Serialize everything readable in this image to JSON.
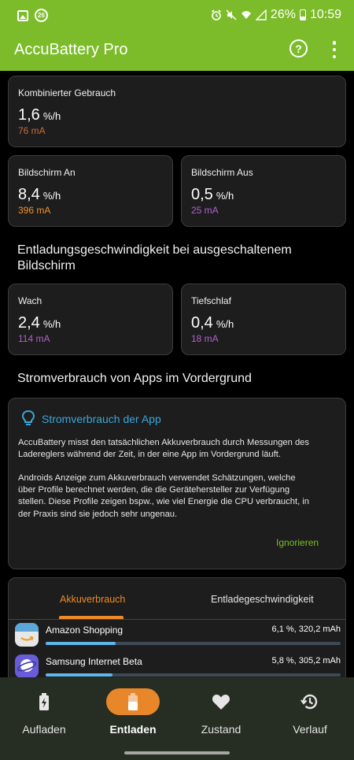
{
  "status_bar": {
    "notification_badge": "26",
    "battery_percent": "26%",
    "time": "10:59"
  },
  "app_bar": {
    "title": "AccuBattery Pro",
    "help_label": "?"
  },
  "combined": {
    "label": "Kombinierter Gebrauch",
    "value": "1,6",
    "unit": "%/h",
    "ma": "76 mA",
    "ma_color": "#c36d3a"
  },
  "screen_on": {
    "label": "Bildschirm An",
    "value": "8,4",
    "unit": "%/h",
    "ma": "396 mA",
    "ma_color": "#f0932b"
  },
  "screen_off": {
    "label": "Bildschirm Aus",
    "value": "0,5",
    "unit": "%/h",
    "ma": "25 mA",
    "ma_color": "#b15fd0"
  },
  "discharge_section": {
    "title_line1": "Entladungsgeschwindigkeit bei ausgeschaltenem",
    "title_line2": "Bildschirm"
  },
  "awake": {
    "label": "Wach",
    "value": "2,4",
    "unit": "%/h",
    "ma": "114 mA",
    "ma_color": "#b15fd0"
  },
  "deep_sleep": {
    "label": "Tiefschlaf",
    "value": "0,4",
    "unit": "%/h",
    "ma": "18 mA",
    "ma_color": "#b15fd0"
  },
  "foreground_section": {
    "title": "Stromverbrauch von Apps im Vordergrund"
  },
  "info_card": {
    "icon": "lightbulb-icon",
    "title": "Stromverbrauch der App",
    "paragraph1_line1": "AccuBattery misst den tatsächlichen Akkuverbrauch durch Messungen des",
    "paragraph1_line2": "Ladereglers während der Zeit, in der eine App im Vordergrund läuft.",
    "paragraph2_line1": "Androids Anzeige zum Akkuverbrauch verwendet Schätzungen, welche",
    "paragraph2_line2": "über Profile berechnet werden, die die Gerätehersteller zur Verfügung",
    "paragraph2_line3": "stellen. Diese Profile zeigen bspw., wie viel Energie die CPU verbraucht, in",
    "paragraph2_line4": "der Praxis sind sie jedoch sehr ungenau.",
    "ignore_label": "Ignorieren"
  },
  "tabs": {
    "usage_label": "Akkuverbrauch",
    "speed_label": "Entladegeschwindigkeit",
    "active": "usage"
  },
  "apps": [
    {
      "name": "Amazon Shopping",
      "stat": "6,1 %, 320,2 mAh",
      "share": 0.061,
      "icon": "amazon-shopping-icon"
    },
    {
      "name": "Samsung Internet Beta",
      "stat": "5,8 %, 305,2 mAh",
      "share": 0.058,
      "icon": "samsung-internet-beta-icon"
    }
  ],
  "bottom_nav": {
    "charge_label": "Aufladen",
    "discharge_label": "Entladen",
    "health_label": "Zustand",
    "history_label": "Verlauf",
    "active": "discharge"
  },
  "colors": {
    "accent_green": "#7cbc2a",
    "accent_orange": "#e8872a",
    "info_blue": "#39a6dc",
    "bar_blue": "#5fb6ea"
  }
}
